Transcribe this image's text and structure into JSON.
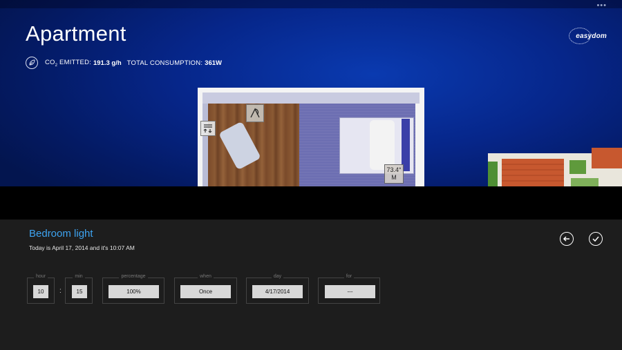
{
  "window": {
    "more_label": "•••"
  },
  "header": {
    "title": "Apartment"
  },
  "stats": {
    "co2_label": "CO",
    "co2_sub": "2",
    "co2_label_suffix": " EMITTED:",
    "co2_value": "191.3 g/h",
    "consumption_label": "TOTAL CONSUMPTION:",
    "consumption_value": "361W"
  },
  "logo": {
    "text": "easydom"
  },
  "floorplan": {
    "thermostat_value": "73.4°",
    "thermostat_mode": "M"
  },
  "panel": {
    "title": "Bedroom light",
    "subtitle": "Today is April 17, 2014 and  it's 10:07 AM",
    "back_icon": "arrow-left-circle-icon",
    "confirm_icon": "check-circle-icon"
  },
  "form": {
    "hour": {
      "label": "hour",
      "value": "10"
    },
    "separator": ":",
    "min": {
      "label": "min",
      "value": "15"
    },
    "percentage": {
      "label": "percentage",
      "value": "100%"
    },
    "when": {
      "label": "when",
      "value": "Once"
    },
    "day": {
      "label": "day",
      "value": "4/17/2014"
    },
    "for": {
      "label": "for",
      "value": "---"
    }
  }
}
